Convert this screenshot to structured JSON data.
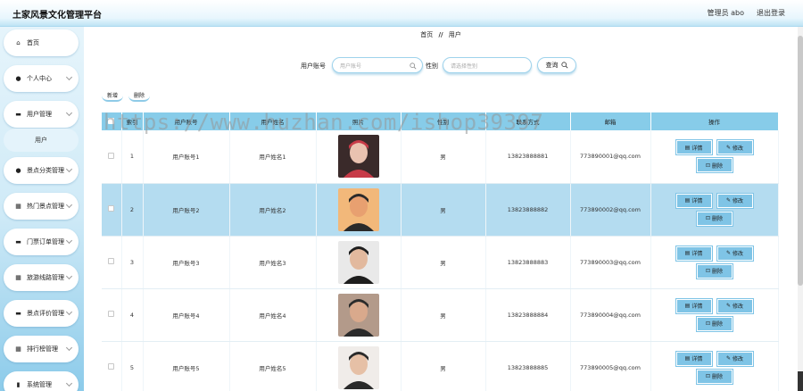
{
  "header": {
    "app_title": "土家风景文化管理平台",
    "admin_label": "管理员 abo",
    "logout_label": "退出登录"
  },
  "sidebar": {
    "items": [
      {
        "label": "首页",
        "icon": "home-icon",
        "glyph": "⌂",
        "has_chevron": false
      },
      {
        "label": "个人中心",
        "icon": "user-icon",
        "glyph": "●",
        "has_chevron": true
      },
      {
        "label": "用户管理",
        "icon": "folder-icon",
        "glyph": "▬",
        "has_chevron": true
      },
      {
        "label": "景点分类管理",
        "icon": "user-icon",
        "glyph": "●",
        "has_chevron": true
      },
      {
        "label": "热门景点管理",
        "icon": "grid-icon",
        "glyph": "▦",
        "has_chevron": true
      },
      {
        "label": "门票订单管理",
        "icon": "ticket-icon",
        "glyph": "▬",
        "has_chevron": true
      },
      {
        "label": "旅游线路管理",
        "icon": "grid-icon",
        "glyph": "▦",
        "has_chevron": true
      },
      {
        "label": "景点评价管理",
        "icon": "comment-icon",
        "glyph": "▬",
        "has_chevron": true
      },
      {
        "label": "排行榜管理",
        "icon": "grid-icon",
        "glyph": "▦",
        "has_chevron": true
      },
      {
        "label": "系统管理",
        "icon": "chart-icon",
        "glyph": "▮",
        "has_chevron": true
      }
    ],
    "sub_item": "用户"
  },
  "breadcrumb": {
    "home": "首页",
    "sep": "//",
    "current": "用户"
  },
  "search": {
    "account_label": "用户账号",
    "account_placeholder": "用户账号",
    "gender_label": "性别",
    "gender_placeholder": "请选择性别",
    "query_label": "查询"
  },
  "actions": {
    "add": "新增",
    "delete": "删除"
  },
  "watermark": "https://www.huzhan.com/ishop39397",
  "table": {
    "columns": [
      "索引",
      "用户账号",
      "用户姓名",
      "照片",
      "性别",
      "联系方式",
      "邮箱",
      "操作"
    ],
    "detail_label": "详情",
    "edit_label": "修改",
    "delete_label": "删除",
    "rows": [
      {
        "index": "1",
        "account": "用户账号1",
        "name": "用户姓名1",
        "gender": "男",
        "phone": "13823888881",
        "email": "773890001@qq.com"
      },
      {
        "index": "2",
        "account": "用户账号2",
        "name": "用户姓名2",
        "gender": "男",
        "phone": "13823888882",
        "email": "773890002@qq.com"
      },
      {
        "index": "3",
        "account": "用户账号3",
        "name": "用户姓名3",
        "gender": "男",
        "phone": "13823888883",
        "email": "773890003@qq.com"
      },
      {
        "index": "4",
        "account": "用户账号4",
        "name": "用户姓名4",
        "gender": "男",
        "phone": "13823888884",
        "email": "773890004@qq.com"
      },
      {
        "index": "5",
        "account": "用户账号5",
        "name": "用户姓名5",
        "gender": "男",
        "phone": "13823888885",
        "email": "773890005@qq.com"
      }
    ]
  },
  "colors": {
    "accent": "#87cce9",
    "highlight_row": "#b4dcf0",
    "button": "#7fc4e6"
  }
}
